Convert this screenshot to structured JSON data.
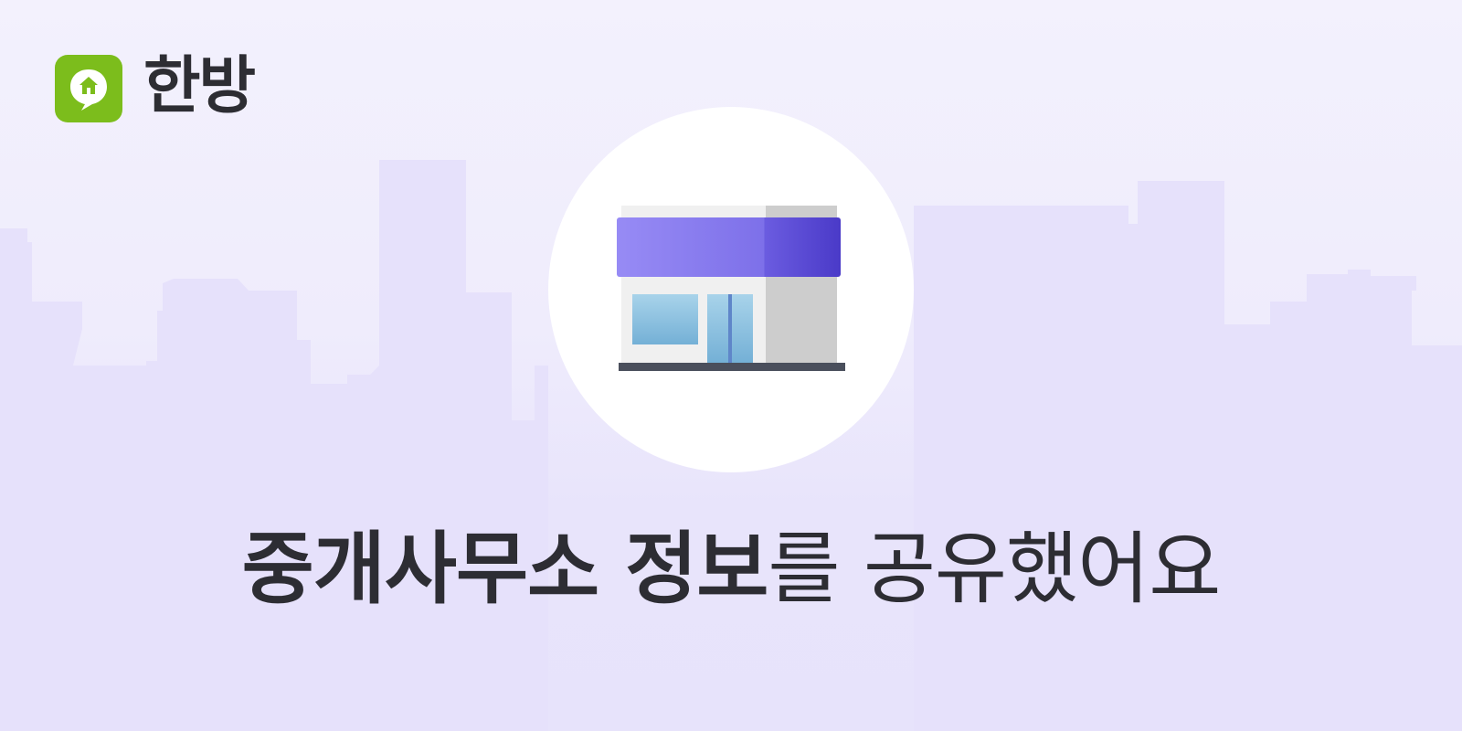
{
  "brand": {
    "name": "한방",
    "logo_icon": "house-chat-icon",
    "logo_color": "#7cbd1c"
  },
  "illustration": {
    "icon": "storefront-icon",
    "awning_color": "#7d6ff0"
  },
  "headline": {
    "emphasis": "중개사무소 정보",
    "rest": "를 공유했어요"
  },
  "colors": {
    "background": "#e9e5fb",
    "text": "#2d2d33"
  }
}
